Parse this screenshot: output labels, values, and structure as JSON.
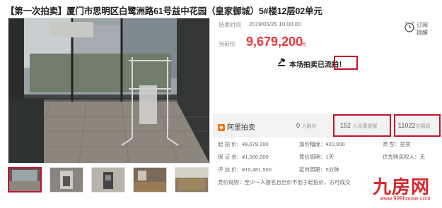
{
  "title": "【第一次拍卖】厦门市思明区白鹭洲路61号益中花园（皇家御城）5#楼12层02单元",
  "end_time": {
    "label": "结束时间",
    "value": "2019/05/25 10:00:00"
  },
  "remind": {
    "label": "订阅\n提醒"
  },
  "price": {
    "label": "当前价",
    "value": "9,679,200",
    "unit": "元"
  },
  "notice": {
    "text": "本场拍卖已流拍！"
  },
  "stats": {
    "brand": "阿里拍卖",
    "signup_count": "0",
    "signup_label": "人报名",
    "reminder_count": "152",
    "reminder_label": "人设置提醒",
    "views_count": "11022",
    "views_label": "次围观"
  },
  "details": {
    "start_price": "起 拍 价：¥9,679,200",
    "increment": "加价幅度：¥20,000",
    "sale_type": "类    型：拍卖",
    "deposit": "保 证 金：¥1,000,000",
    "period": "竞价周期：1天",
    "priority": "优先购买权人：无",
    "appraisal": "评 估 价：¥10,481,500",
    "delay": "延时周期：5分钟",
    "rules": "竞价规则：至少一人报名且出价不低于起拍价，方可成交"
  },
  "watermark": {
    "name": "九房网",
    "url": "www.999house.com"
  },
  "colors": {
    "accent": "#e4393c",
    "highlight_box": "#c8102e",
    "brand_orange": "#ff6a00"
  }
}
